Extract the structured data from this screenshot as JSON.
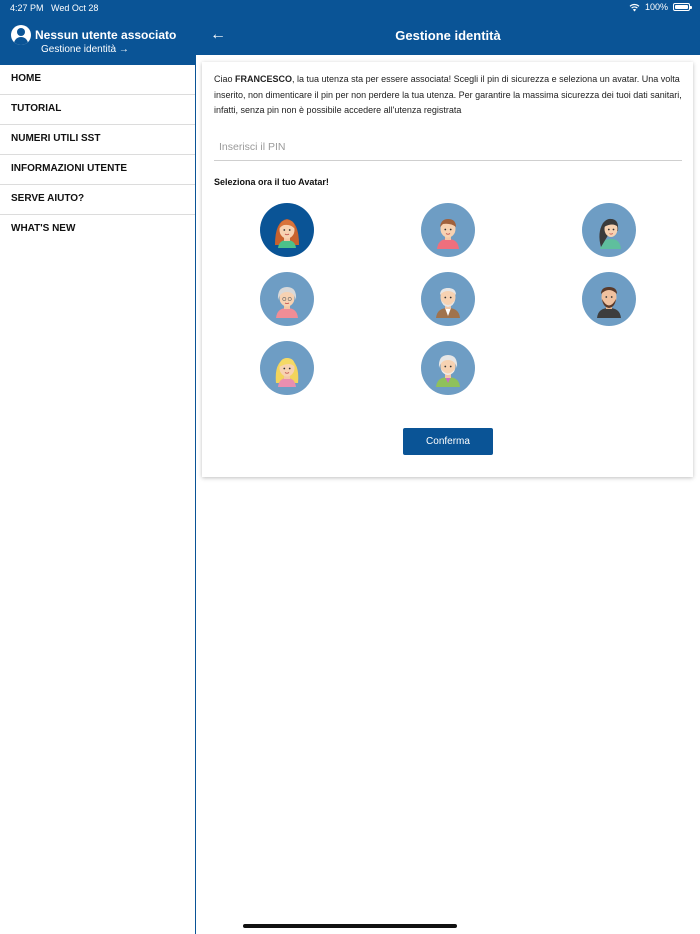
{
  "status_bar": {
    "time": "4:27 PM",
    "date": "Wed Oct 28",
    "battery": "100%"
  },
  "sidebar": {
    "user_name": "Nessun utente associato",
    "identity_link": "Gestione identità",
    "items": [
      {
        "label": "HOME"
      },
      {
        "label": "TUTORIAL"
      },
      {
        "label": "NUMERI UTILI SST"
      },
      {
        "label": "INFORMAZIONI UTENTE"
      },
      {
        "label": "SERVE AIUTO?"
      },
      {
        "label": "WHAT'S NEW"
      }
    ]
  },
  "header": {
    "title": "Gestione identità"
  },
  "card": {
    "greeting_prefix": "Ciao ",
    "user_first_name": "FRANCESCO",
    "intro_text": ", la tua utenza sta per essere associata! Scegli il pin di sicurezza e seleziona un avatar. Una volta inserito, non dimenticare il pin per non perdere la tua utenza. Per garantire la massima sicurezza dei tuoi dati sanitari, infatti, senza pin non è possibile accedere all'utenza registrata",
    "pin_placeholder": "Inserisci il PIN",
    "avatar_prompt": "Seleziona ora il tuo Avatar!",
    "confirm_label": "Conferma",
    "selected_avatar": 0
  },
  "colors": {
    "primary": "#0a5496",
    "avatar_bg": "#6e9dc4",
    "avatar_selected_bg": "#0a5496"
  }
}
